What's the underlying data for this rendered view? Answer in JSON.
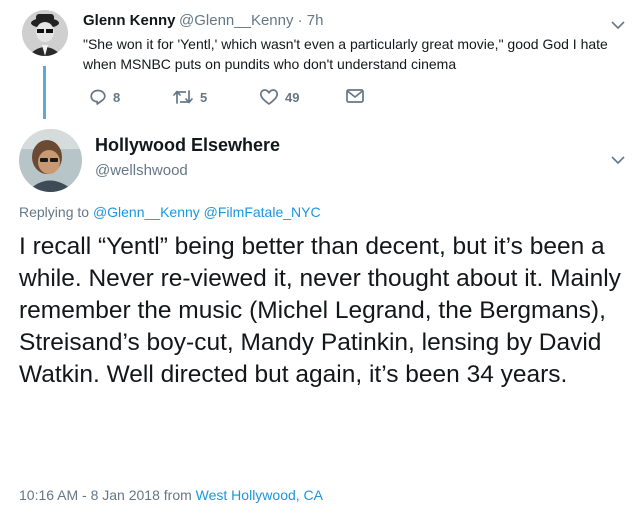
{
  "reply": {
    "display_name": "Glenn Kenny",
    "handle_time": "@Glenn__Kenny · 7h",
    "text": "\"She won it for 'Yentl,' which wasn't even a particularly great movie,\" good God I hate when MSNBC puts on pundits who don't understand cinema",
    "actions": {
      "reply_count": "8",
      "retweet_count": "5",
      "like_count": "49"
    }
  },
  "tweet": {
    "display_name": "Hollywood Elsewhere",
    "handle": "@wellshwood",
    "replying_prefix": "Replying to ",
    "replying_users": [
      "@Glenn__Kenny",
      "@FilmFatale_NYC"
    ],
    "text": "I recall “Yentl” being better than decent, but it’s been a while.  Never re-viewed it, never thought about it.  Mainly remember the music (Michel Legrand, the Bergmans), Streisand’s boy-cut, Mandy Patinkin, lensing by David Watkin.  Well directed but again, it’s been 34 years.",
    "timestamp": "10:16 AM - 8 Jan 2018",
    "from_prefix": " from ",
    "location": "West Hollywood, CA"
  },
  "icons": {
    "reply": "reply-icon",
    "retweet": "retweet-icon",
    "like": "heart-icon",
    "dm": "envelope-icon",
    "menu": "chevron-down-icon"
  },
  "colors": {
    "link": "#1b95e0",
    "secondary_text": "#657786",
    "primary_text": "#14171a",
    "thread_line": "#5fa8d9"
  }
}
